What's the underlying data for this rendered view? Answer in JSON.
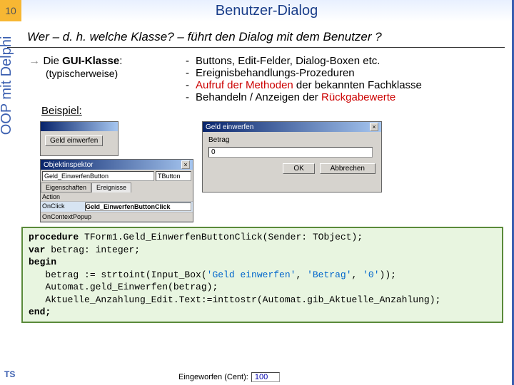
{
  "slide_number": "10",
  "title": "Benutzer-Dialog",
  "subtitle_parts": {
    "a": "Wer  –  ",
    "b": "d. h. welche Klasse?",
    "c": "   –   führt den Dialog mit dem Benutzer ?"
  },
  "side_label": "OOP mit Delphi",
  "ts": "TS",
  "gui_klasse": {
    "label1": "Die ",
    "label2": "GUI-Klasse",
    "label3": ":",
    "sub": "(typischerweise)"
  },
  "bullets": {
    "b1": "Buttons, Edit-Felder, Dialog-Boxen etc.",
    "b2": "Ereignisbehandlungs-Prozeduren",
    "b3a": "Aufruf der Methoden",
    "b3b": " der bekannten Fachklasse",
    "b4a": "Behandeln / Anzeigen der ",
    "b4b": "Rückgabewerte"
  },
  "example_label": "Beispiel:",
  "form_win": {
    "button_label": "Geld einwerfen"
  },
  "oi": {
    "title": "Objektinspektor",
    "combo1": "Geld_EinwerfenButton",
    "combo2": "TButton",
    "tab1": "Eigenschaften",
    "tab2": "Ereignisse",
    "r1a": "Action",
    "r2a": "OnClick",
    "r2b": "Geld_EinwerfenButtonClick",
    "r3a": "OnContextPopup"
  },
  "dlg": {
    "title": "Geld einwerfen",
    "label": "Betrag",
    "value": "0",
    "ok": "OK",
    "cancel": "Abbrechen"
  },
  "code": {
    "l1a": "procedure",
    "l1b": " TForm1.Geld_EinwerfenButtonClick(Sender: TObject);",
    "l2a": "var",
    "l2b": " betrag: integer;",
    "l3": "begin",
    "l4a": "   betrag := strtoint(Input_Box(",
    "l4b": "'Geld einwerfen'",
    "l4c": ",",
    "l4d": " 'Betrag'",
    "l4e": ",",
    "l4f": " '0'",
    "l4g": "));",
    "l5": "   Automat.geld_Einwerfen(betrag);",
    "l6": "   Aktuelle_Anzahlung_Edit.Text:=inttostr(Automat.gib_Aktuelle_Anzahlung);",
    "l7": "end;"
  },
  "bottom": {
    "label": "Eingeworfen (Cent):",
    "value": "100"
  }
}
